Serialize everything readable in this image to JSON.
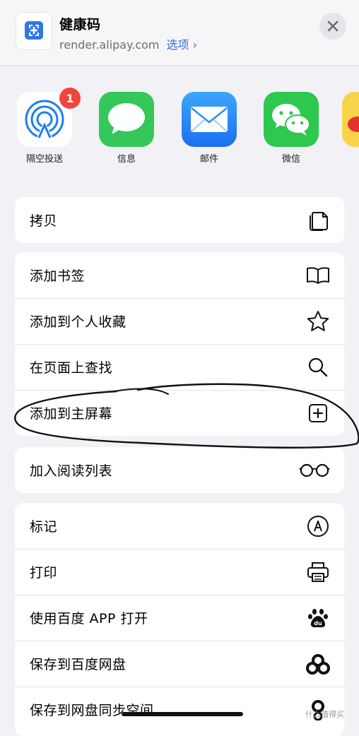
{
  "header": {
    "title": "健康码",
    "subtitle": "render.alipay.com",
    "options_label": "选项 ›"
  },
  "share_apps": [
    {
      "label": "隔空投送",
      "icon": "airdrop-icon",
      "badge": "1",
      "color": "#ffffff"
    },
    {
      "label": "信息",
      "icon": "messages-icon",
      "color": "#34c759"
    },
    {
      "label": "邮件",
      "icon": "mail-icon",
      "color": "#2e8cf7"
    },
    {
      "label": "微信",
      "icon": "wechat-icon",
      "color": "#2dc84d"
    }
  ],
  "actions": {
    "copy": "拷贝",
    "add_bookmark": "添加书签",
    "add_favorites": "添加到个人收藏",
    "find_on_page": "在页面上查找",
    "add_home_screen": "添加到主屏幕",
    "reading_list": "加入阅读列表",
    "markup": "标记",
    "print": "打印",
    "open_baidu_app": "使用百度 APP 打开",
    "save_baidu_pan": "保存到百度网盘",
    "save_pan_sync": "保存到网盘同步空间"
  },
  "watermark": "什么值得买"
}
